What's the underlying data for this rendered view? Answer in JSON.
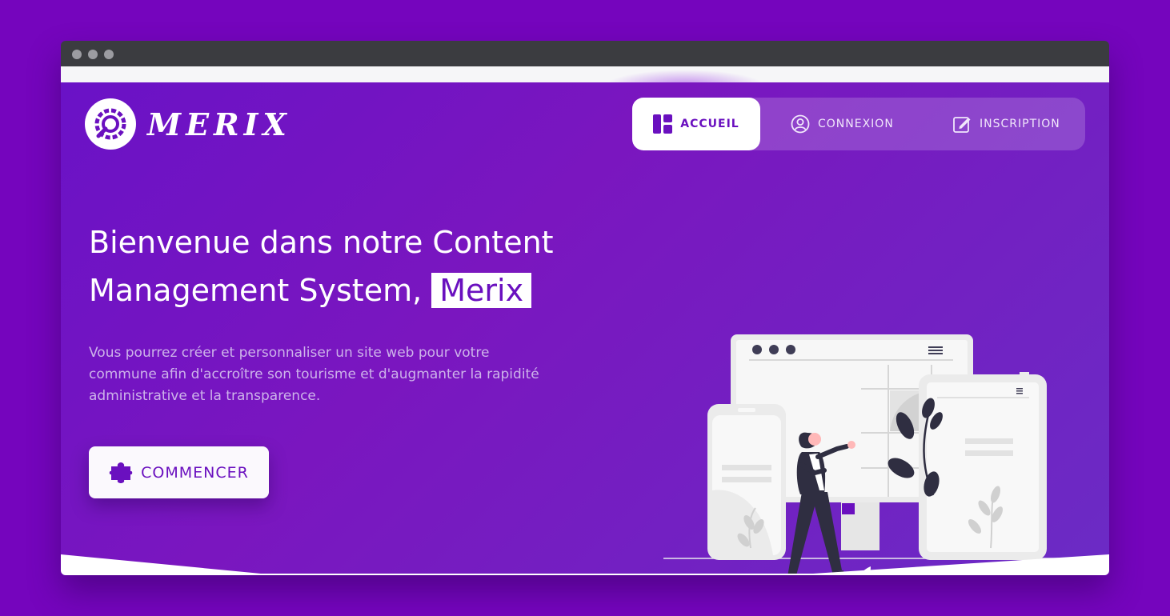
{
  "brand": {
    "name": "MERIX",
    "logo_icon": "wrench-gear-icon"
  },
  "nav": {
    "items": [
      {
        "label": "ACCUEIL",
        "icon": "dashboard-icon",
        "active": true
      },
      {
        "label": "CONNEXION",
        "icon": "user-circle-icon",
        "active": false
      },
      {
        "label": "INSCRIPTION",
        "icon": "edit-icon",
        "active": false
      }
    ]
  },
  "hero": {
    "title_line1": "Bienvenue dans notre Content",
    "title_line2": "Management System, ",
    "title_highlight": "Merix",
    "description": "Vous pourrez créer et personnaliser un site web pour votre commune afin d'accroître son tourisme et d'augmanter la rapidité administrative et la transparence.",
    "cta_label": "COMMENCER",
    "cta_icon": "puzzle-icon"
  },
  "colors": {
    "page_bg": "#7505bd",
    "hero_bg": "#6f13c4",
    "accent": "#6a10bf",
    "text_light": "#cdb3ea"
  }
}
